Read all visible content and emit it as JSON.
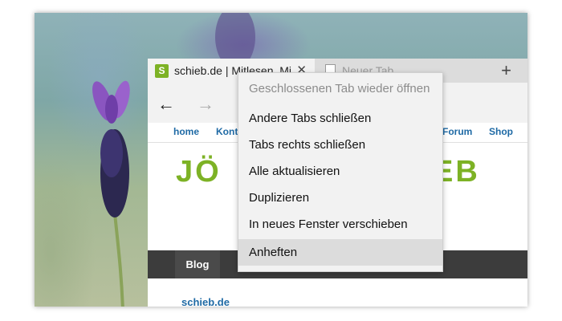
{
  "tabs": [
    {
      "title": "schieb.de | Mitlesen, Mi",
      "favicon_letter": "S",
      "state": "active"
    },
    {
      "title": "Neuer Tab",
      "state": "inactive"
    }
  ],
  "tab_close_glyph": "✕",
  "new_tab_glyph": "+",
  "nav": {
    "back_glyph": "←",
    "forward_glyph": "→"
  },
  "site_nav": {
    "home": "home",
    "kontakt_partial": "Kont",
    "forum": "Forum",
    "shop": "Shop"
  },
  "logo": {
    "left_part": "JÖ",
    "right_part": "EB",
    "color": "#7db225"
  },
  "menubar": {
    "blog": "Blog"
  },
  "breadcrumb_site": "schieb.de",
  "context_menu": {
    "items": [
      {
        "label": "Geschlossenen Tab wieder öffnen",
        "disabled": true
      },
      {
        "label": "Andere Tabs schließen",
        "disabled": false
      },
      {
        "label": "Tabs rechts schließen",
        "disabled": false
      },
      {
        "label": "Alle aktualisieren",
        "disabled": false
      },
      {
        "label": "Duplizieren",
        "disabled": false
      },
      {
        "label": "In neues Fenster verschieben",
        "disabled": false
      },
      {
        "label": "Anheften",
        "disabled": false,
        "highlighted": true
      }
    ]
  },
  "colors": {
    "accent_green": "#7db225",
    "link_blue": "#1f6aa5",
    "dark_bar": "#3c3c3c"
  }
}
